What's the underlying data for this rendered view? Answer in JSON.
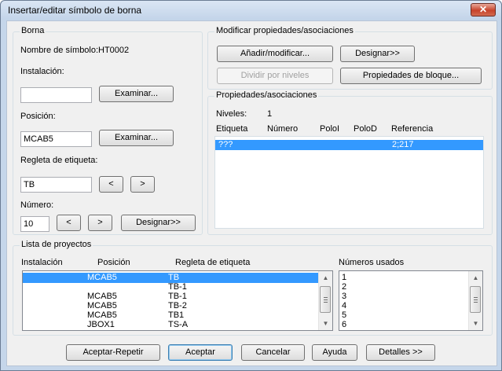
{
  "window": {
    "title": "Insertar/editar símbolo de borna",
    "close_glyph": "✕"
  },
  "borna": {
    "group_label": "Borna",
    "symbol_name_label": "Nombre de símbolo:",
    "symbol_name_value": "HT0002",
    "installation_label": "Instalación:",
    "installation_value": "",
    "browse_label": "Examinar...",
    "position_label": "Posición:",
    "position_value": "MCAB5",
    "browse2_label": "Examinar...",
    "tag_strip_label": "Regleta de etiqueta:",
    "tag_strip_value": "TB",
    "prev_label": "<",
    "next_label": ">",
    "number_label": "Número:",
    "number_value": "10",
    "prev2_label": "<",
    "next2_label": ">",
    "designate_label": "Designar>>"
  },
  "modify": {
    "group_label": "Modificar propiedades/asociaciones",
    "add_modify_label": "Añadir/modificar...",
    "designate_label": "Designar>>",
    "split_label": "Dividir por niveles",
    "block_props_label": "Propiedades de bloque..."
  },
  "props": {
    "group_label": "Propiedades/asociaciones",
    "levels_label": "Niveles:",
    "levels_value": "1",
    "columns": [
      "Etiqueta",
      "Número",
      "PoloI",
      "PoloD",
      "Referencia"
    ],
    "rows": [
      {
        "etiqueta": "???",
        "numero": "",
        "poloi": "",
        "polod": "",
        "referencia": "2;217",
        "selected": true
      }
    ]
  },
  "projects": {
    "group_label": "Lista de proyectos",
    "columns": [
      "Instalación",
      "Posición",
      "Regleta de etiqueta"
    ],
    "rows": [
      {
        "instalacion": "",
        "posicion": "MCAB5",
        "regleta": "TB",
        "selected": true
      },
      {
        "instalacion": "",
        "posicion": "",
        "regleta": "TB-1",
        "selected": false
      },
      {
        "instalacion": "",
        "posicion": "MCAB5",
        "regleta": "TB-1",
        "selected": false
      },
      {
        "instalacion": "",
        "posicion": "MCAB5",
        "regleta": "TB-2",
        "selected": false
      },
      {
        "instalacion": "",
        "posicion": "MCAB5",
        "regleta": "TB1",
        "selected": false
      },
      {
        "instalacion": "",
        "posicion": "JBOX1",
        "regleta": "TS-A",
        "selected": false
      }
    ],
    "used_numbers_label": "Números usados",
    "used_numbers": [
      "1",
      "2",
      "3",
      "4",
      "5",
      "6"
    ]
  },
  "footer": {
    "accept_repeat_label": "Aceptar-Repetir",
    "accept_label": "Aceptar",
    "cancel_label": "Cancelar",
    "help_label": "Ayuda",
    "details_label": "Detalles >>"
  },
  "icons": {
    "scroll_up": "▲",
    "scroll_down": "▼"
  },
  "colors": {
    "selection": "#3399ff",
    "close_button": "#c7432b",
    "titlebar": "#c5d6ea"
  }
}
